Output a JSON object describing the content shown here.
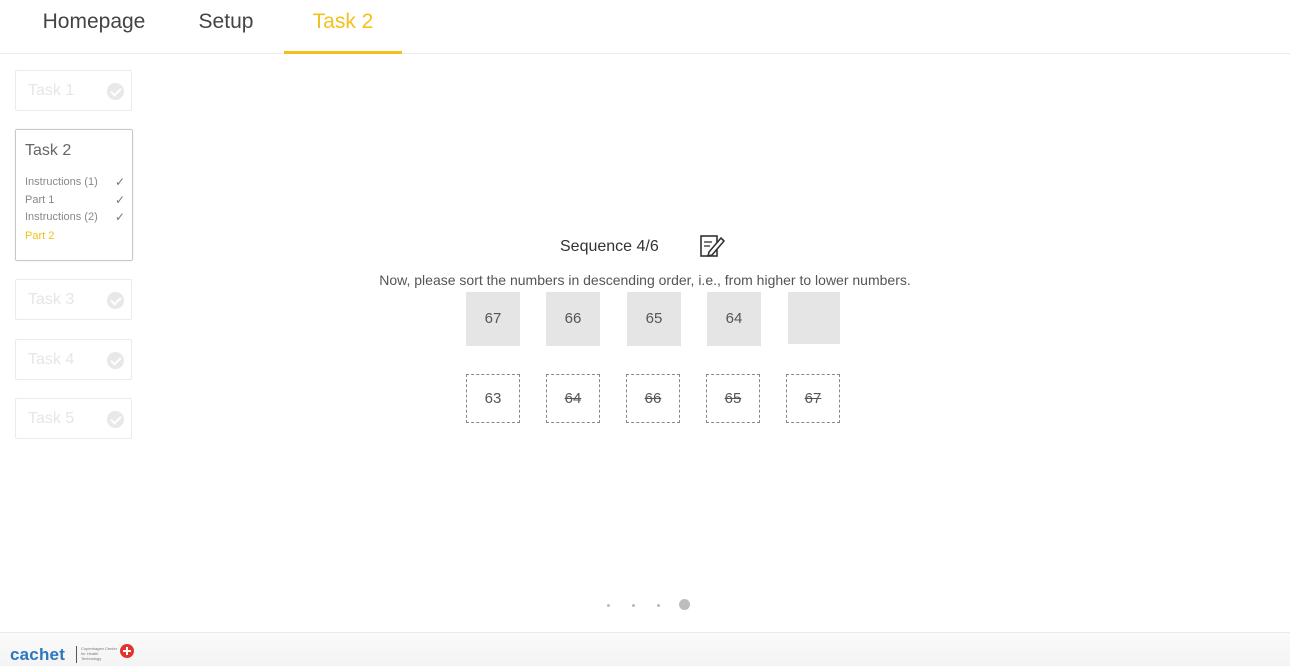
{
  "nav": {
    "tabs": [
      {
        "label": "Homepage",
        "active": false
      },
      {
        "label": "Setup",
        "active": false
      },
      {
        "label": "Task 2",
        "active": true
      }
    ],
    "accent_color": "#f3c11a"
  },
  "sidebar": {
    "tasks": [
      {
        "label": "Task 1",
        "status": "done"
      },
      {
        "label": "Task 2",
        "status": "current"
      },
      {
        "label": "Task 3",
        "status": "pending"
      },
      {
        "label": "Task 4",
        "status": "pending"
      },
      {
        "label": "Task 5",
        "status": "pending"
      }
    ],
    "current_steps": [
      {
        "label": "Instructions (1)",
        "done": true
      },
      {
        "label": "Part 1",
        "done": true
      },
      {
        "label": "Instructions (2)",
        "done": true
      },
      {
        "label": "Part 2",
        "done": false,
        "active": true
      }
    ],
    "check_glyph": "✓"
  },
  "main": {
    "sequence_label": "Sequence 4/6",
    "edit_icon": "edit-note-icon",
    "instruction": "Now, please sort the numbers in descending order, i.e., from higher to lower numbers.",
    "answer_slots": [
      "67",
      "66",
      "65",
      "64",
      ""
    ],
    "source_numbers": [
      {
        "value": "63",
        "used": false
      },
      {
        "value": "64",
        "used": true
      },
      {
        "value": "66",
        "used": true
      },
      {
        "value": "65",
        "used": true
      },
      {
        "value": "67",
        "used": true
      }
    ]
  },
  "pager": {
    "count": 4,
    "active_index": 3
  },
  "footer": {
    "logo_text": "cachet",
    "logo_subtext": "Copenhagen Center for Health Technology"
  }
}
